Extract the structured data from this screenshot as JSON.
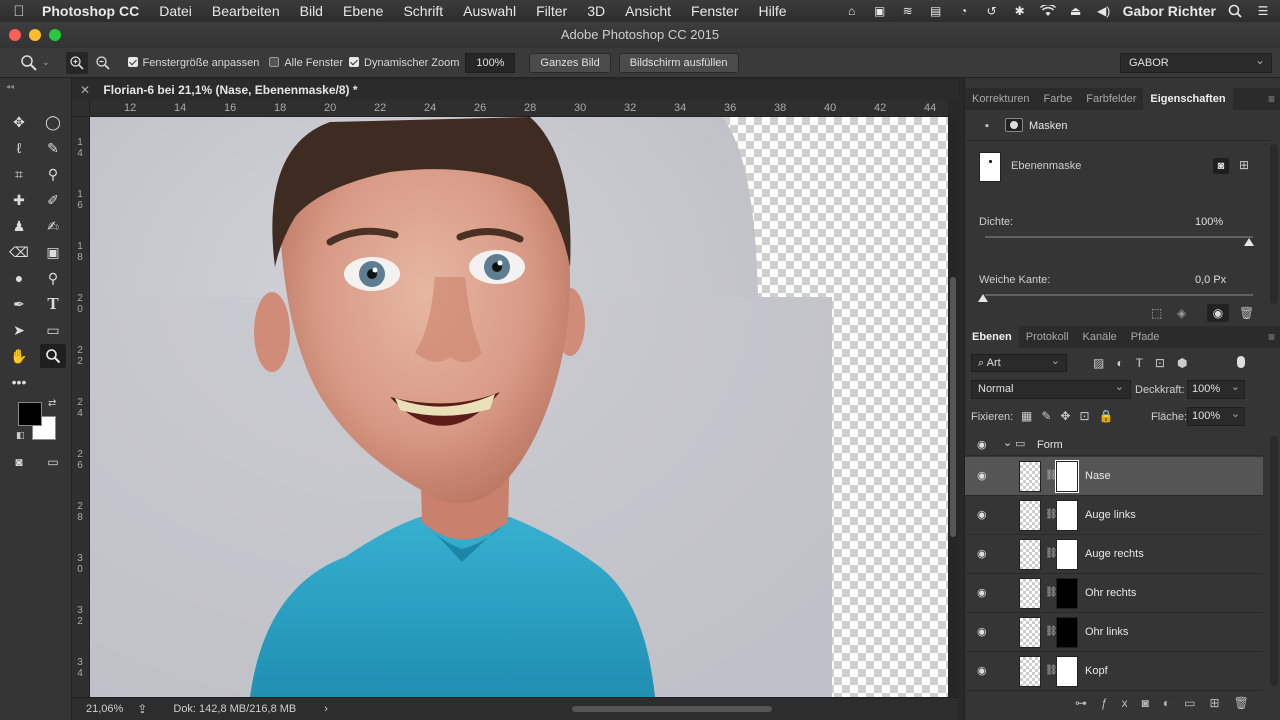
{
  "menubar": {
    "app": "Photoshop CC",
    "items": [
      "Datei",
      "Bearbeiten",
      "Bild",
      "Ebene",
      "Schrift",
      "Auswahl",
      "Filter",
      "3D",
      "Ansicht",
      "Fenster",
      "Hilfe"
    ],
    "user": "Gabor Richter"
  },
  "window": {
    "title": "Adobe Photoshop CC 2015"
  },
  "options": {
    "fit_window_label": "Fenstergröße anpassen",
    "all_windows_label": "Alle Fenster",
    "dynamic_zoom_label": "Dynamischer Zoom",
    "zoom_value": "100%",
    "full_image_label": "Ganzes Bild",
    "fill_screen_label": "Bildschirm ausfüllen",
    "workspace": "GABOR"
  },
  "document": {
    "tab_title": "Florian-6 bei 21,1% (Nase, Ebenenmaske/8) *",
    "ruler_h": [
      "12",
      "14",
      "16",
      "18",
      "20",
      "22",
      "24",
      "26",
      "28",
      "30",
      "32",
      "34",
      "36",
      "38",
      "40",
      "42",
      "44"
    ],
    "ruler_v": [
      "1\n4",
      "1\n6",
      "1\n8",
      "2\n0",
      "2\n2",
      "2\n4",
      "2\n6",
      "2\n8",
      "3\n0",
      "3\n2",
      "3\n4"
    ]
  },
  "status": {
    "zoom": "21,06%",
    "doc_info": "Dok: 142,8 MB/216,8 MB"
  },
  "properties_panel": {
    "tabs": [
      "Korrekturen",
      "Farbe",
      "Farbfelder",
      "Eigenschaften"
    ],
    "section_title": "Masken",
    "mask_name": "Ebenenmaske",
    "density_label": "Dichte:",
    "density_value": "100%",
    "feather_label": "Weiche Kante:",
    "feather_value": "0,0 Px"
  },
  "layers_panel": {
    "tabs": [
      "Ebenen",
      "Protokoll",
      "Kanäle",
      "Pfade"
    ],
    "filter_kind": "Art",
    "blend_mode": "Normal",
    "opacity_label": "Deckkraft:",
    "opacity_value": "100%",
    "lock_label": "Fixieren:",
    "fill_label": "Fläche:",
    "fill_value": "100%",
    "group_name": "Form",
    "layers": [
      {
        "name": "Nase",
        "mask": "white",
        "selected": true
      },
      {
        "name": "Auge links",
        "mask": "white",
        "selected": false
      },
      {
        "name": "Auge rechts",
        "mask": "white",
        "selected": false
      },
      {
        "name": "Ohr rechts",
        "mask": "black",
        "selected": false
      },
      {
        "name": "Ohr links",
        "mask": "black",
        "selected": false
      },
      {
        "name": "Kopf",
        "mask": "white",
        "selected": false
      }
    ]
  },
  "colors": {
    "foreground": "#000000",
    "background": "#ffffff",
    "shirt": "#2a9fc2"
  }
}
